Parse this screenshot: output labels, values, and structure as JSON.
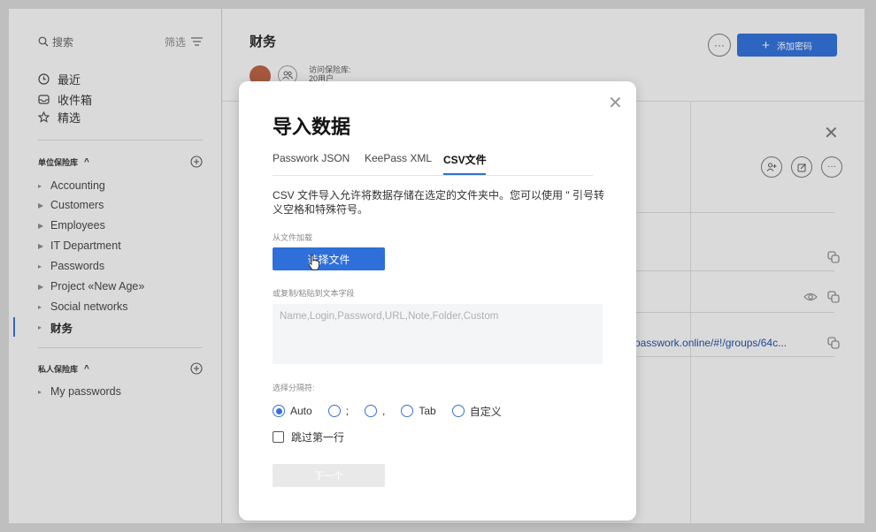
{
  "sidebar": {
    "search_label": "搜索",
    "filter_label": "筛选",
    "nav": [
      {
        "label": "最近",
        "icon": "clock-icon"
      },
      {
        "label": "收件箱",
        "icon": "inbox-icon"
      },
      {
        "label": "精选",
        "icon": "star-icon"
      }
    ],
    "org_vault_title": "单位保险库",
    "org_items": [
      "Accounting",
      "Customers",
      "Employees",
      "IT Department",
      "Passwords",
      "Project «New Age»",
      "Social networks",
      "财务"
    ],
    "private_vault_title": "私人保险库",
    "private_items": [
      "My passwords"
    ]
  },
  "main": {
    "title": "财务",
    "access_label": "访问保险库:",
    "access_sub": "20用户",
    "add_button": "添加密码",
    "url": "passwork.online/#!/groups/64c..."
  },
  "dialog": {
    "title": "导入数据",
    "tabs": [
      "Passwork JSON",
      "KeePass XML",
      "CSV文件"
    ],
    "active_tab": "CSV文件",
    "description": "CSV 文件导入允许将数据存储在选定的文件夹中。您可以使用 \" 引号转义空格和特殊符号。",
    "from_file_label": "从文件加载",
    "choose_file_button": "选择文件",
    "paste_label": "或复制/粘贴到文本字段",
    "textarea_placeholder": "Name,Login,Password,URL,Note,Folder,Custom",
    "separator_label": "选择分隔符:",
    "separators": [
      "Auto",
      ";",
      ",",
      "Tab",
      "自定义"
    ],
    "selected_separator": "Auto",
    "skip_first_row_label": "跳过第一行",
    "next_button": "下一个"
  },
  "colors": {
    "accent": "#2e6fd9",
    "disabled": "#e9e9e9"
  }
}
